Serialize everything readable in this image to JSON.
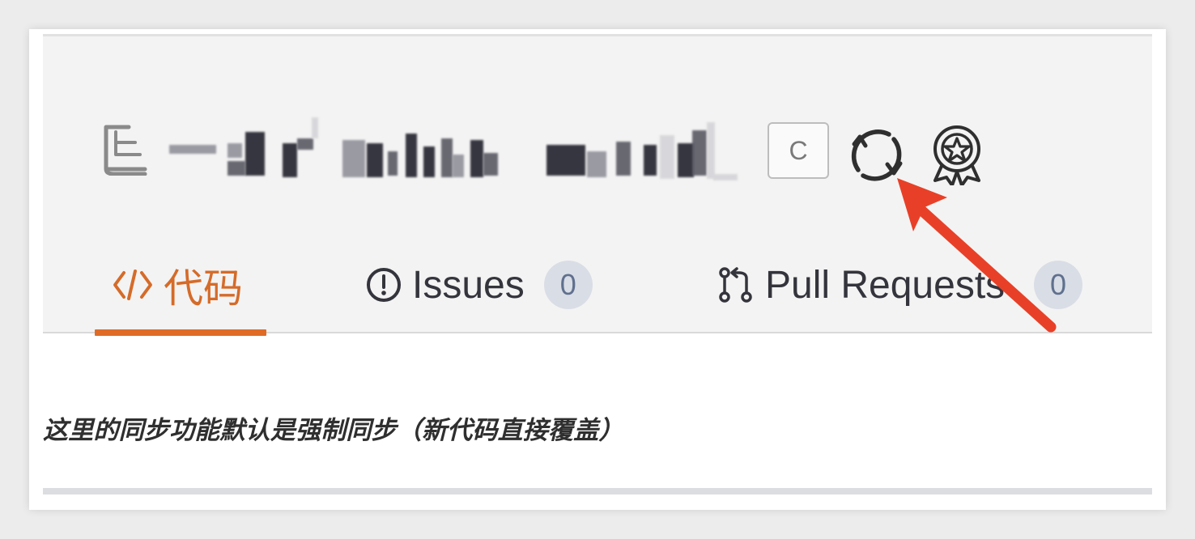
{
  "repository": {
    "blurred_name": "",
    "badge_label": "C"
  },
  "tabs": [
    {
      "label": "代码",
      "icon": "code-brackets-icon",
      "active": true
    },
    {
      "label": "Issues",
      "icon": "issue-opened-icon",
      "count": "0",
      "active": false
    },
    {
      "label": "Pull Requests",
      "icon": "pull-request-icon",
      "count": "0",
      "active": false
    }
  ],
  "annotation": {
    "note": "这里的同步功能默认是强制同步（新代码直接覆盖）"
  },
  "colors": {
    "active_tab": "#d56b29",
    "active_underline": "#e06b26",
    "highlight_arrow": "#e84028",
    "count_badge_bg": "#d9dde5",
    "header_bg": "#f3f3f3"
  },
  "icons": {
    "repo": "repository-book-icon",
    "sync": "sync-icon",
    "award": "award-badge-icon"
  }
}
